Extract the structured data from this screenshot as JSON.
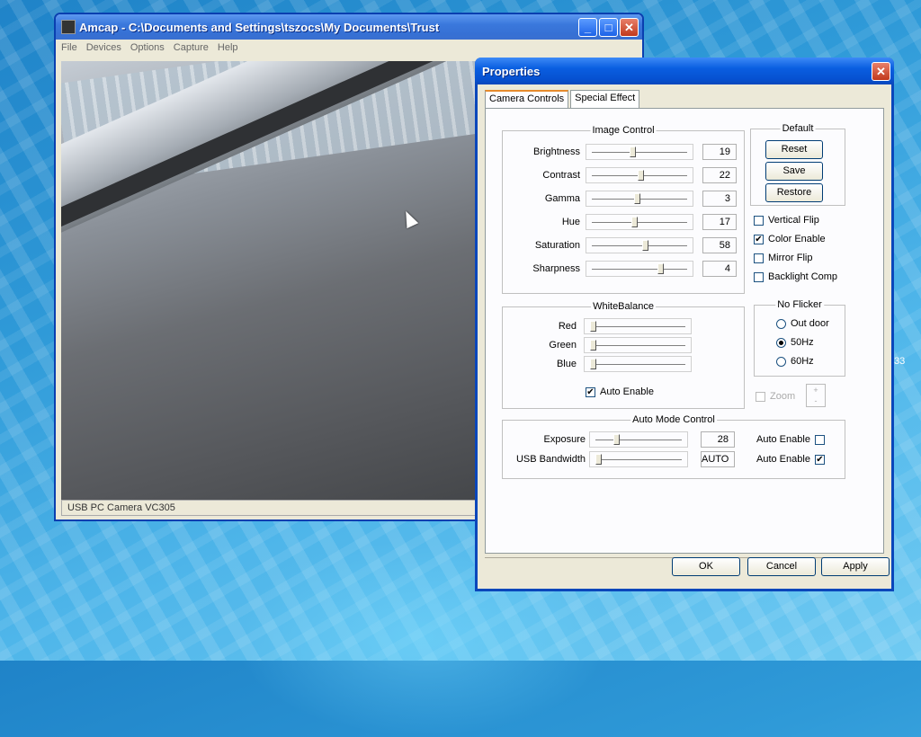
{
  "amcap": {
    "title": "Amcap - C:\\Documents and Settings\\tszocs\\My Documents\\Trust",
    "menu": [
      "File",
      "Devices",
      "Options",
      "Capture",
      "Help"
    ],
    "status": "USB PC Camera VC305",
    "buttons": {
      "minimize": "_",
      "maximize": "□",
      "close": "✕"
    }
  },
  "properties": {
    "title": "Properties",
    "close": "✕",
    "tabs": [
      "Camera Controls",
      "Special Effect"
    ],
    "image_control": {
      "legend": "Image Control",
      "rows": [
        {
          "label": "Brightness",
          "value": "19",
          "pos": 0.42
        },
        {
          "label": "Contrast",
          "value": "22",
          "pos": 0.5
        },
        {
          "label": "Gamma",
          "value": "3",
          "pos": 0.47
        },
        {
          "label": "Hue",
          "value": "17",
          "pos": 0.44
        },
        {
          "label": "Saturation",
          "value": "58",
          "pos": 0.55
        },
        {
          "label": "Sharpness",
          "value": "4",
          "pos": 0.72
        }
      ]
    },
    "default": {
      "legend": "Default",
      "reset": "Reset",
      "save": "Save",
      "restore": "Restore"
    },
    "flags": [
      {
        "label": "Vertical Flip",
        "checked": false
      },
      {
        "label": "Color Enable",
        "checked": true
      },
      {
        "label": "Mirror Flip",
        "checked": false
      },
      {
        "label": "Backlight Comp",
        "checked": false
      }
    ],
    "white_balance": {
      "legend": "WhiteBalance",
      "rows": [
        {
          "label": "Red",
          "pos": 0.0
        },
        {
          "label": "Green",
          "pos": 0.0
        },
        {
          "label": "Blue",
          "pos": 0.0
        }
      ],
      "auto_label": "Auto Enable",
      "auto_checked": true
    },
    "no_flicker": {
      "legend": "No Flicker",
      "options": [
        {
          "label": "Out door",
          "selected": false
        },
        {
          "label": "50Hz",
          "selected": true
        },
        {
          "label": "60Hz",
          "selected": false
        }
      ]
    },
    "zoom": {
      "label": "Zoom",
      "spin_up": "+",
      "spin_down": "-"
    },
    "auto_mode": {
      "legend": "Auto Mode Control",
      "rows": [
        {
          "label": "Exposure",
          "value": "28",
          "pos": 0.22,
          "auto_label": "Auto Enable",
          "auto_checked": false
        },
        {
          "label": "USB Bandwidth",
          "value": "AUTO",
          "pos": 0.0,
          "auto_label": "Auto Enable",
          "auto_checked": true
        }
      ]
    },
    "buttons": {
      "ok": "OK",
      "cancel": "Cancel",
      "apply": "Apply"
    }
  },
  "desktop": {
    "edge_text": "33"
  }
}
